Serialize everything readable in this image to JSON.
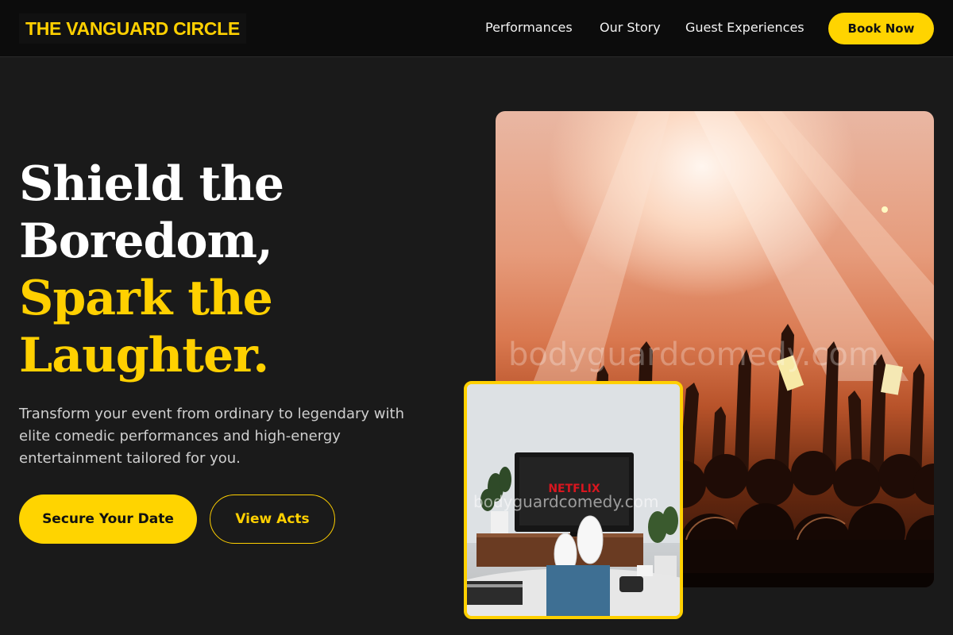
{
  "header": {
    "brand": "THE VANGUARD CIRCLE",
    "nav": [
      "Performances",
      "Our Story",
      "Guest Experiences"
    ],
    "cta": "Book Now"
  },
  "hero": {
    "headline_line1": "Shield the",
    "headline_line2": "Boredom,",
    "headline_accent_line1": "Spark the",
    "headline_accent_line2": "Laughter.",
    "subtext": "Transform your event from ordinary to legendary with elite comedic performances and high-energy entertainment tailored for you.",
    "primary_button": "Secure Your Date",
    "secondary_button": "View Acts"
  },
  "images": {
    "concert_watermark": "bodyguardcomedy.com",
    "inset_watermark": "bodyguardcomedy.com",
    "tv_brand": "NETFLIX"
  },
  "colors": {
    "accent": "#ffd000",
    "background": "#1a1a1a",
    "header_bg": "#0c0c0c"
  }
}
